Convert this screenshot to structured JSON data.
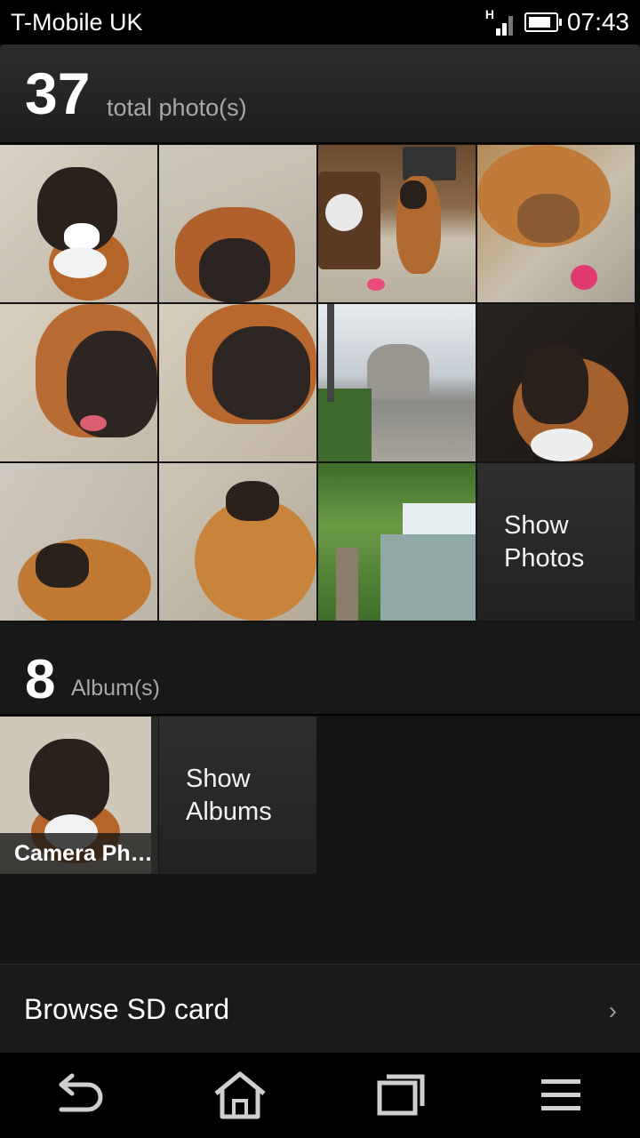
{
  "status_bar": {
    "carrier": "T-Mobile UK",
    "network_type": "H",
    "time": "07:43",
    "battery_level": 0.85
  },
  "photos_section": {
    "count": "37",
    "label": "total photo(s)",
    "show_label_line1": "Show",
    "show_label_line2": "Photos"
  },
  "albums_section": {
    "count": "8",
    "label": "Album(s)",
    "album_name": "Camera Ph…",
    "show_label_line1": "Show",
    "show_label_line2": "Albums"
  },
  "browse": {
    "label": "Browse SD card",
    "chevron": "›"
  },
  "nav_icons": [
    "back-icon",
    "home-icon",
    "recent-apps-icon",
    "menu-icon"
  ]
}
